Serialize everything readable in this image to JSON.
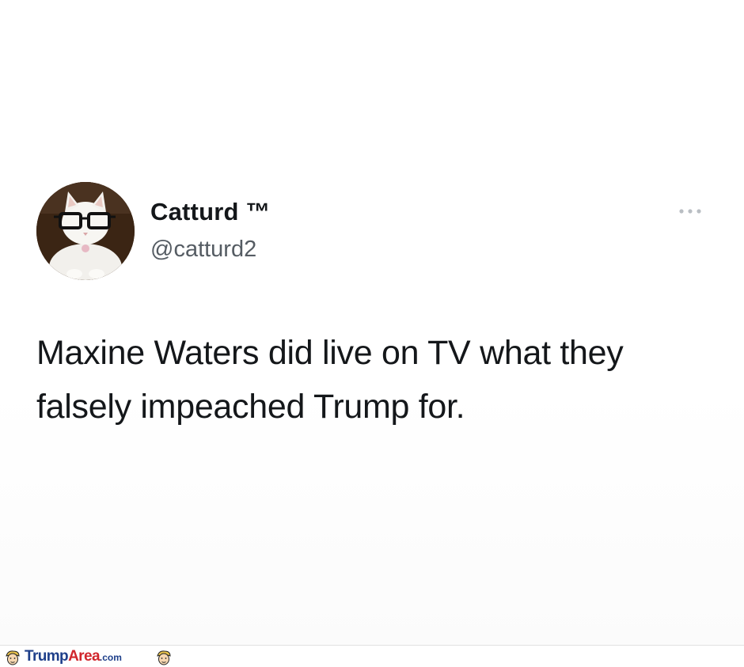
{
  "tweet": {
    "display_name": "Catturd ™",
    "handle": "@catturd2",
    "text": "Maxine Waters did live on TV what they falsely impeached Trump for.",
    "more_icon": "more-horizontal-icon",
    "avatar_icon": "cat-with-glasses-avatar"
  },
  "watermark": {
    "brand_part1": "Trump",
    "brand_part2": "Area",
    "brand_suffix": ".com",
    "icon": "trump-caricature-icon"
  },
  "colors": {
    "text": "#14171a",
    "handle": "#555c63",
    "brand_blue": "#1e3f8a",
    "brand_red": "#d1262c"
  }
}
